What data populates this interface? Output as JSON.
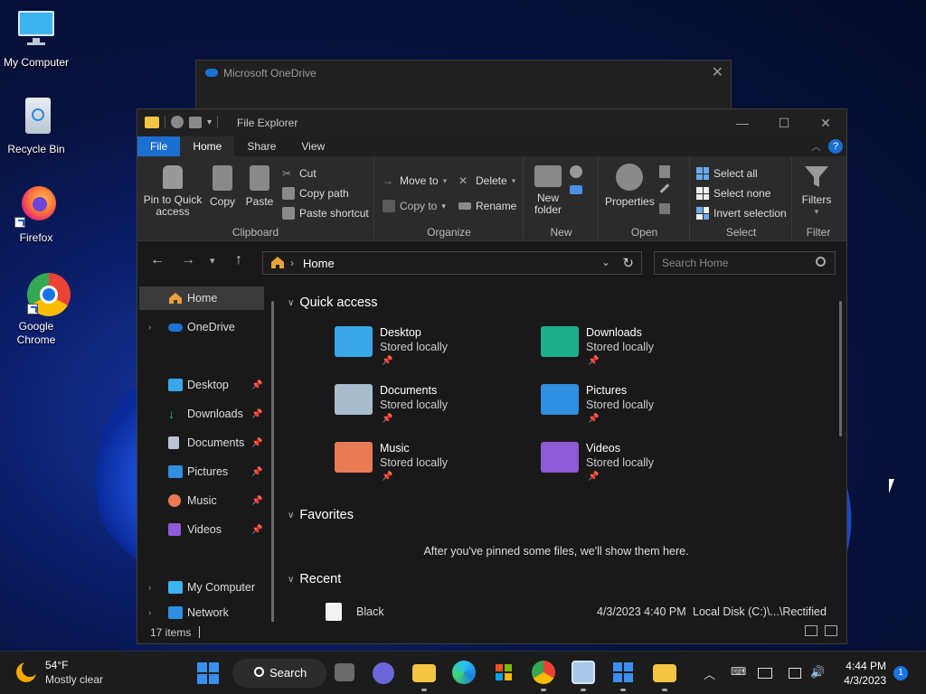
{
  "desktop": {
    "icons": [
      {
        "label": "My Computer"
      },
      {
        "label": "Recycle Bin"
      },
      {
        "label": "Firefox"
      },
      {
        "label": "Google Chrome"
      }
    ]
  },
  "onedrive_window": {
    "title": "Microsoft OneDrive"
  },
  "explorer": {
    "title": "File Explorer",
    "tabs": [
      {
        "label": "File"
      },
      {
        "label": "Home"
      },
      {
        "label": "Share"
      },
      {
        "label": "View"
      }
    ],
    "ribbon": {
      "clipboard": {
        "group_label": "Clipboard",
        "pin_quick_access": "Pin to Quick access",
        "copy": "Copy",
        "paste": "Paste",
        "cut": "Cut",
        "copy_path": "Copy path",
        "paste_shortcut": "Paste shortcut"
      },
      "organize": {
        "group_label": "Organize",
        "move_to": "Move to",
        "copy_to": "Copy to",
        "delete": "Delete",
        "rename": "Rename"
      },
      "new": {
        "group_label": "New",
        "new_folder": "New folder"
      },
      "open": {
        "group_label": "Open",
        "properties": "Properties"
      },
      "select": {
        "group_label": "Select",
        "select_all": "Select all",
        "select_none": "Select none",
        "invert_selection": "Invert selection"
      },
      "filter": {
        "group_label": "Filter",
        "filters": "Filters"
      }
    },
    "address": {
      "crumb": "Home",
      "search_placeholder": "Search Home"
    },
    "nav_pane": {
      "items": [
        {
          "label": "Home"
        },
        {
          "label": "OneDrive"
        },
        {
          "label": "Desktop"
        },
        {
          "label": "Downloads"
        },
        {
          "label": "Documents"
        },
        {
          "label": "Pictures"
        },
        {
          "label": "Music"
        },
        {
          "label": "Videos"
        },
        {
          "label": "My Computer"
        },
        {
          "label": "Network"
        }
      ]
    },
    "quick_access": {
      "heading": "Quick access",
      "folders": [
        {
          "name": "Desktop",
          "sub": "Stored locally",
          "color": "#3aa7e8"
        },
        {
          "name": "Downloads",
          "sub": "Stored locally",
          "color": "#1fae8a"
        },
        {
          "name": "Documents",
          "sub": "Stored locally",
          "color": "#a9bccc"
        },
        {
          "name": "Pictures",
          "sub": "Stored locally",
          "color": "#2f8fe0"
        },
        {
          "name": "Music",
          "sub": "Stored locally",
          "color": "#e87a56"
        },
        {
          "name": "Videos",
          "sub": "Stored locally",
          "color": "#8e5ad6"
        }
      ]
    },
    "favorites": {
      "heading": "Favorites",
      "empty_message": "After you've pinned some files, we'll show them here."
    },
    "recent": {
      "heading": "Recent",
      "items": [
        {
          "name": "Black",
          "date": "4/3/2023 4:40 PM",
          "location": "Local Disk (C:)\\...\\Rectified"
        }
      ]
    },
    "status": {
      "item_count": "17 items"
    }
  },
  "taskbar": {
    "weather": {
      "temp": "54°F",
      "condition": "Mostly clear"
    },
    "search_label": "Search",
    "clock": {
      "time": "4:44 PM",
      "date": "4/3/2023"
    },
    "notification_count": "1"
  }
}
